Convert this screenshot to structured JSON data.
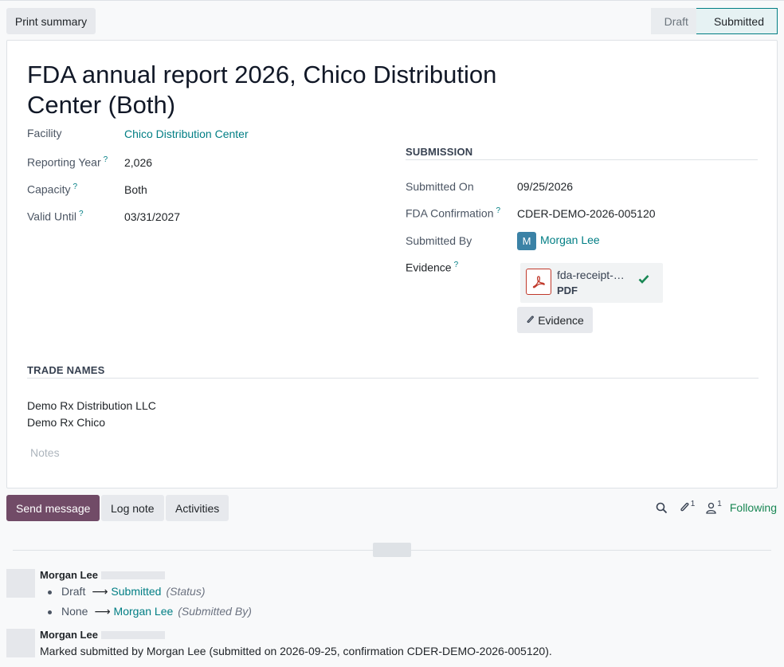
{
  "toolbar": {
    "print_label": "Print summary"
  },
  "statusbar": {
    "steps": [
      {
        "label": "Draft",
        "active": false
      },
      {
        "label": "Submitted",
        "active": true
      }
    ]
  },
  "record": {
    "title": "FDA annual report 2026, Chico Distribution Center (Both)",
    "fields": {
      "facility": {
        "label": "Facility",
        "value": "Chico Distribution Center"
      },
      "reporting_year": {
        "label": "Reporting Year",
        "value": "2,026"
      },
      "capacity": {
        "label": "Capacity",
        "value": "Both"
      },
      "valid_until": {
        "label": "Valid Until",
        "value": "03/31/2027"
      }
    },
    "help_mark": "?",
    "submission": {
      "section_title": "SUBMISSION",
      "submitted_on": {
        "label": "Submitted On",
        "value": "09/25/2026"
      },
      "fda_confirmation": {
        "label": "FDA Confirmation",
        "value": "CDER-DEMO-2026-005120"
      },
      "submitted_by": {
        "label": "Submitted By",
        "value": "Morgan Lee",
        "avatar_letter": "M",
        "avatar_color": "#3b82a6"
      },
      "evidence": {
        "label": "Evidence",
        "attachment": {
          "name": "fda-receipt-…",
          "type": "PDF"
        },
        "button_label": "Evidence"
      }
    },
    "trade_names": {
      "section_title": "TRADE NAMES",
      "items": [
        "Demo Rx Distribution LLC",
        "Demo Rx Chico"
      ]
    },
    "notes_placeholder": "Notes"
  },
  "chatter": {
    "send_label": "Send message",
    "log_label": "Log note",
    "activities_label": "Activities",
    "attachment_count": "1",
    "follower_count": "1",
    "following_label": "Following",
    "messages": [
      {
        "author": "Morgan Lee",
        "tracking": [
          {
            "old": "Draft",
            "new": "Submitted",
            "field": "(Status)"
          },
          {
            "old": "None",
            "new": "Morgan Lee",
            "field": "(Submitted By)"
          }
        ]
      },
      {
        "author": "Morgan Lee",
        "body": "Marked submitted by Morgan Lee (submitted on 2026-09-25, confirmation CDER-DEMO-2026-005120)."
      }
    ]
  },
  "colors": {
    "primary": "#714b67",
    "link": "#017e84",
    "following": "#198754"
  },
  "icons": {
    "search": "search-icon",
    "paperclip": "paperclip-icon",
    "user": "user-icon",
    "check": "check-icon",
    "pdf": "pdf-icon"
  }
}
